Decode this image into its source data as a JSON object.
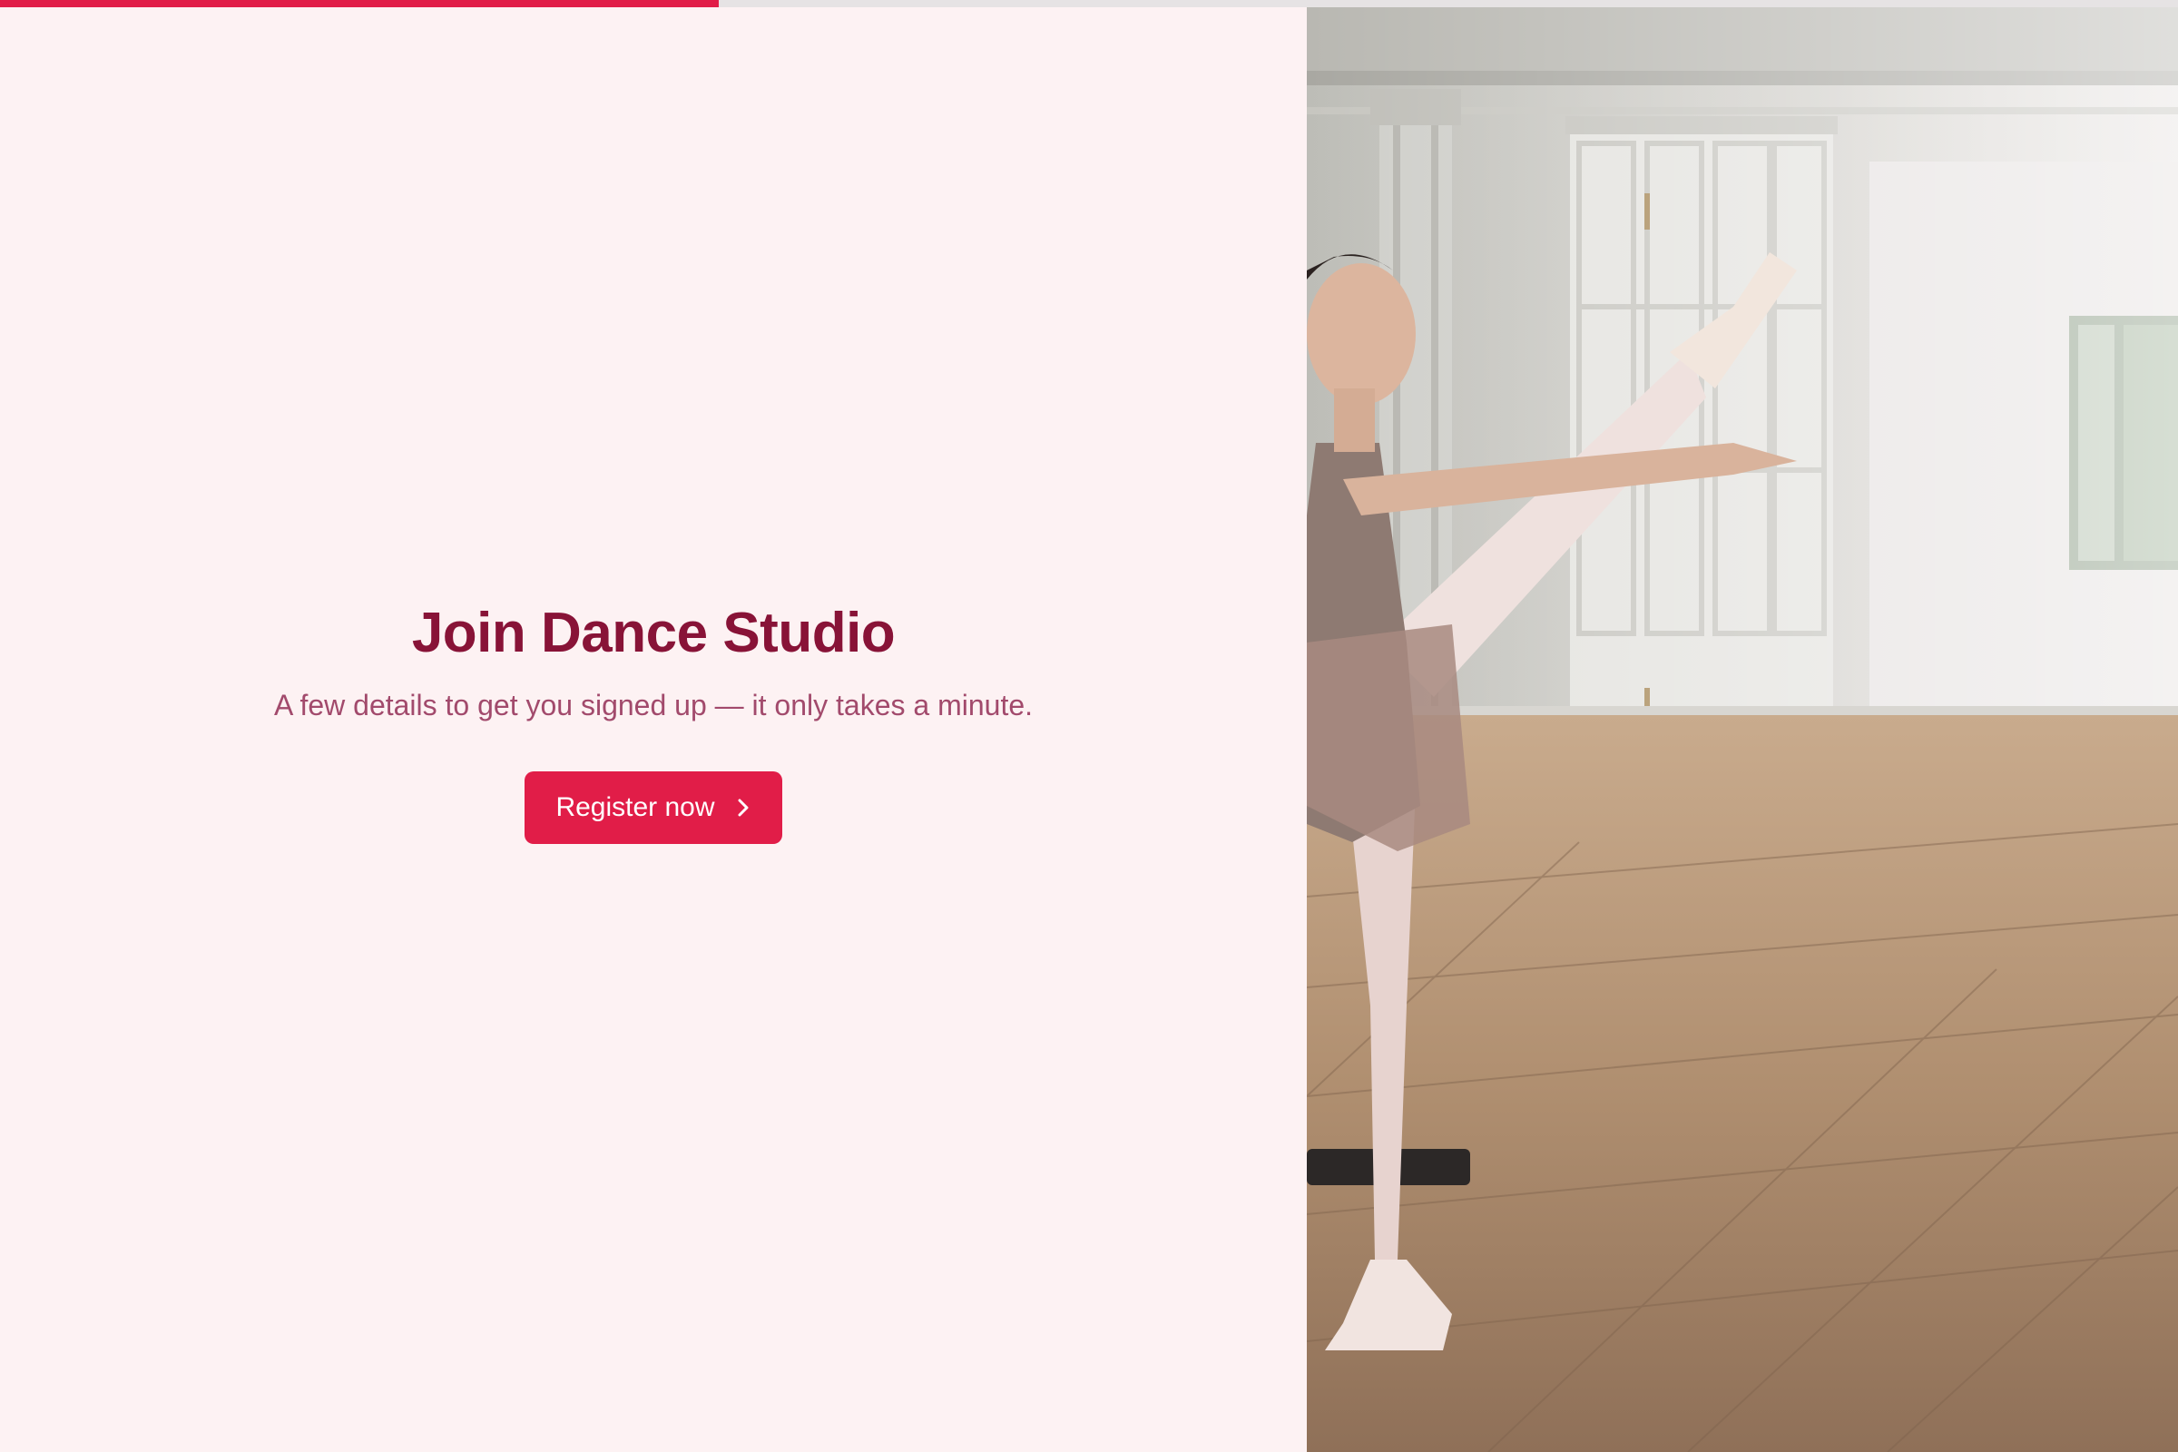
{
  "progress": {
    "fraction": 0.33
  },
  "hero": {
    "title": "Join Dance Studio",
    "subtitle": "A few details to get you signed up — it only takes a minute.",
    "cta_label": "Register now",
    "cta_icon": "chevron-right-icon"
  },
  "photo": {
    "subject": "ballerina-studio-photo"
  },
  "colors": {
    "accent": "#e11d48",
    "title": "#881337",
    "subtitle": "#a24a6c",
    "background": "#fdf2f3",
    "progress_track": "#e6e3e4"
  }
}
